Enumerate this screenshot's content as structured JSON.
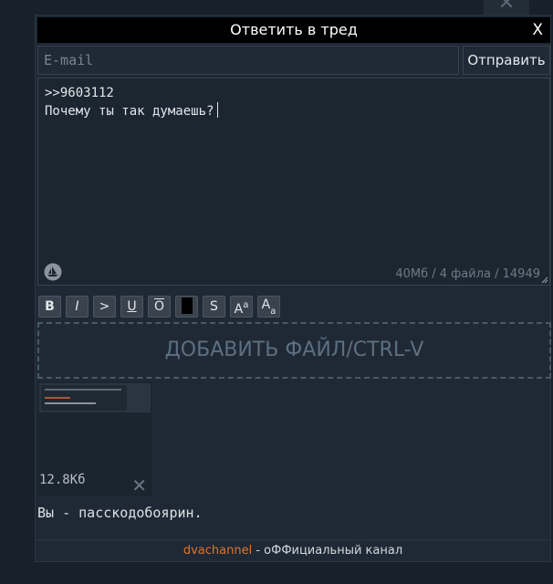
{
  "form": {
    "title": "Ответить в тред",
    "close_label": "X",
    "email_placeholder": "E-mail",
    "email_value": "",
    "send_label": "Отправить",
    "message_line1": ">>9603112",
    "message_line2": "Почему ты так думаешь?",
    "limits": "40Мб / 4 файла / 14949"
  },
  "toolbar": {
    "buttons": [
      {
        "name": "bold",
        "label": "B"
      },
      {
        "name": "italic",
        "label": "I"
      },
      {
        "name": "quote",
        "label": ">"
      },
      {
        "name": "underline",
        "label": "U"
      },
      {
        "name": "overline",
        "label": "O"
      },
      {
        "name": "spoiler",
        "label": ""
      },
      {
        "name": "strike",
        "label": "S"
      },
      {
        "name": "superscript",
        "label_main": "A",
        "label_small": "a"
      },
      {
        "name": "subscript",
        "label_main": "A",
        "label_small": "a"
      }
    ]
  },
  "dropzone": {
    "label": "ДОБАВИТЬ ФАЙЛ/CTRL-V"
  },
  "attachment": {
    "size": "12.8Кб",
    "remove_label": "✕"
  },
  "caption": "Вы - пасскодобоярин.",
  "footer": {
    "link_text": "dvachannel",
    "rest_text": " - оФФициальный канал"
  },
  "colors": {
    "background": "#17202b",
    "panel": "#1e2935",
    "header": "#000000",
    "footer_link": "#e0732e",
    "dropzone_text": "#5d6f80"
  },
  "icons": [
    "ship-icon",
    "close-icon",
    "resize-icon",
    "remove-file-icon"
  ]
}
